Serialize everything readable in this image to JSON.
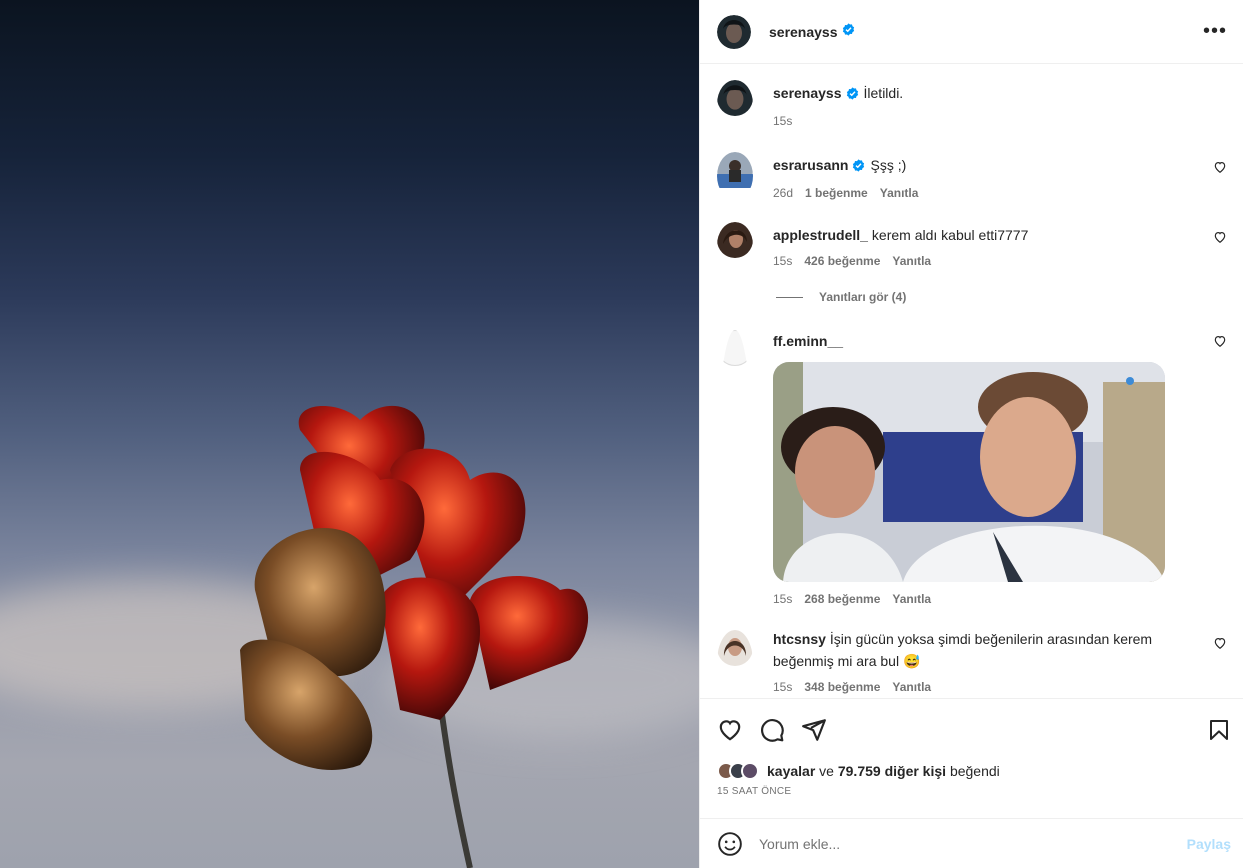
{
  "post": {
    "author": "serenayss",
    "author_verified": true,
    "more_icon": "more-horizontal-icon"
  },
  "caption": {
    "username": "serenayss",
    "text": "İletildi.",
    "time": "15s"
  },
  "comments": [
    {
      "username": "esrarusann",
      "verified": true,
      "text": "Şşş ;)",
      "time": "26d",
      "likes": "1 beğenme",
      "reply": "Yanıtla"
    },
    {
      "username": "applestrudell_",
      "verified": false,
      "text": "kerem aldı kabul etti7777",
      "time": "15s",
      "likes": "426 beğenme",
      "reply": "Yanıtla",
      "view_replies": "Yanıtları gör (4)"
    },
    {
      "username": "ff.eminn__",
      "verified": false,
      "text": "",
      "has_gif": true,
      "time": "15s",
      "likes": "268 beğenme",
      "reply": "Yanıtla"
    },
    {
      "username": "htcsnsy",
      "verified": false,
      "text": "İşin gücün yoksa şimdi beğenilerin arasından kerem beğenmiş mi ara bul 😅",
      "time": "15s",
      "likes": "348 beğenme",
      "reply": "Yanıtla"
    }
  ],
  "likes_line": {
    "first_user": "kayalar",
    "connector": "ve",
    "others": "79.759 diğer kişi",
    "suffix": "beğendi"
  },
  "timestamp": "15 SAAT ÖNCE",
  "add_comment": {
    "placeholder": "Yorum ekle...",
    "share_label": "Paylaş"
  },
  "colors": {
    "verified": "#0095f6",
    "link_disabled": "#b2dffc",
    "secondary_text": "#737373"
  }
}
